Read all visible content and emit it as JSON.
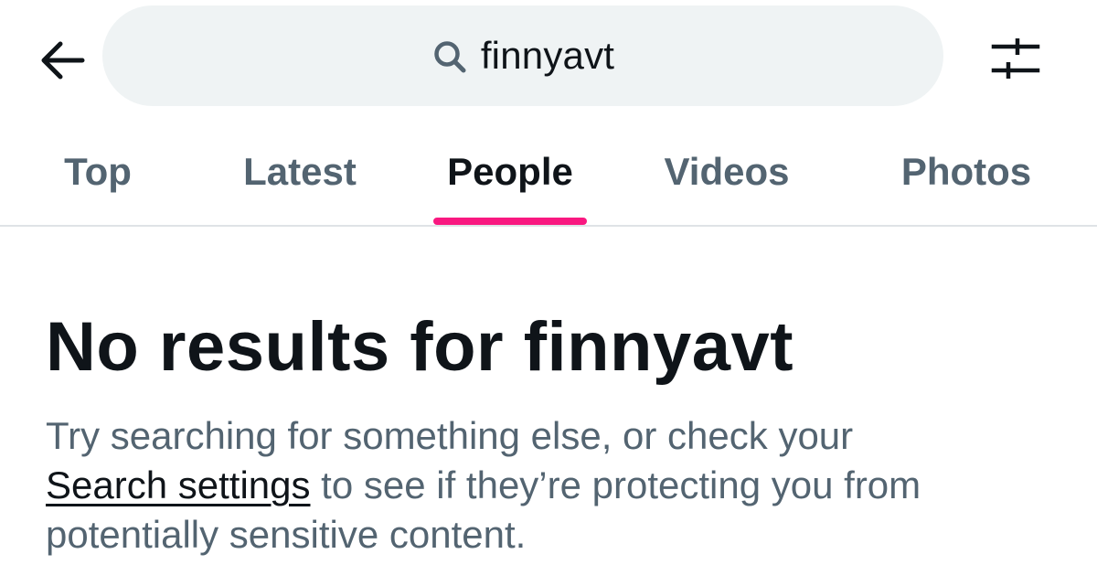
{
  "header": {
    "back_icon": "arrow-left-icon",
    "search": {
      "icon": "search-icon",
      "query": "finnyavt"
    },
    "filter_icon": "sliders-icon"
  },
  "tabs": [
    {
      "label": "Top",
      "active": false
    },
    {
      "label": "Latest",
      "active": false
    },
    {
      "label": "People",
      "active": true
    },
    {
      "label": "Videos",
      "active": false
    },
    {
      "label": "Photos",
      "active": false
    }
  ],
  "colors": {
    "accent": "#f91880",
    "text_primary": "#0f1419",
    "text_secondary": "#536471",
    "search_bg": "#eff3f4"
  },
  "empty_state": {
    "title": "No results for finnyavt",
    "body_before": "Try searching for something else, or check your",
    "link": "Search settings",
    "body_after": "to see if they’re protecting you from potentially sensitive content."
  }
}
